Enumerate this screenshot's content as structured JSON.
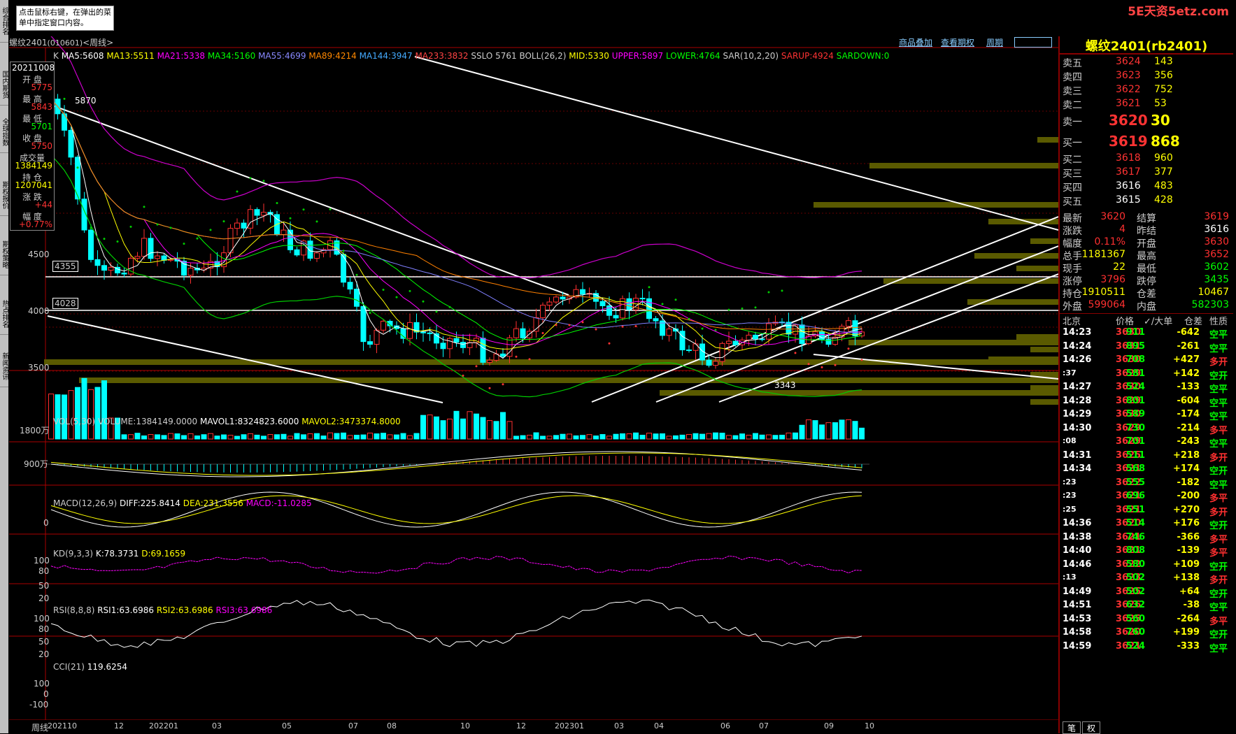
{
  "header": {
    "tip": "点击鼠标右键，在弹出的菜单中指定窗口内容。",
    "logo": "5E天资5etz.com"
  },
  "left_tabs": [
    "综合排名",
    "国内期货",
    "全球指数",
    "期权报价",
    "期权策略",
    "热点排名",
    "新闻资讯"
  ],
  "title": {
    "name": "螺纹2401",
    "code": "(010601)",
    "period": "<周线>"
  },
  "menu": {
    "overlay": "商品叠加",
    "options": "查看期权",
    "cycle": "周期"
  },
  "main_indicator": {
    "k": "K",
    "ma5": "MA5:5608",
    "ma13": "MA13:5511",
    "ma21": "MA21:5338",
    "ma34": "MA34:5160",
    "ma55": "MA55:4699",
    "ma89": "MA89:4214",
    "ma144": "MA144:3947",
    "ma233": "MA233:3832",
    "sslo": "SSLO 5761",
    "boll": "BOLL(26,2)",
    "mid": "MID:5330",
    "upper": "UPPER:5897",
    "lower": "LOWER:4764",
    "sar": "SAR(10,2,20)",
    "sarup": "SARUP:4924",
    "sardown": "SARDOWN:0"
  },
  "colors": {
    "up": "#ff3030",
    "down": "#00ffff",
    "ma5": "#ffffff",
    "ma13": "#ffff00",
    "ma21": "#ff00ff",
    "ma34": "#00ff00",
    "ma55": "#8080ff",
    "ma89": "#ff8000",
    "ma144": "#4080ff",
    "ma233": "#ff4040",
    "volume_band": "#5a5a00"
  },
  "infobox": {
    "date": "20211008",
    "open_label": "开 盘",
    "open": "5775",
    "high_label": "最 高",
    "high": "5843",
    "low_label": "最 低",
    "low": "5701",
    "close_label": "收 盘",
    "close": "5750",
    "vol_label": "成交量",
    "vol": "1384149",
    "oi_label": "持 仓",
    "oi": "1207041",
    "chg_label": "涨 跌",
    "chg": "+44",
    "pct_label": "幅 度",
    "pct": "+0.77%"
  },
  "price_axis": {
    "p4500": "4500",
    "p4000": "4000",
    "p3500": "3500",
    "mark4355": "4355",
    "mark4028": "4028",
    "high_mark": "5870",
    "low_mark": "3343"
  },
  "vol_indicator": {
    "name": "VOL(5,30)",
    "volume": "VOLUME:1384149.0000",
    "mavol1": "MAVOL1:8324823.6000",
    "mavol2": "MAVOL2:3473374.8000",
    "ax1": "1800万",
    "ax2": "900万"
  },
  "macd_indicator": {
    "name": "MACD(12,26,9)",
    "diff": "DIFF:225.8414",
    "dea": "DEA:231.3556",
    "macd": "MACD:-11.0285",
    "ax0": "0"
  },
  "kd_indicator": {
    "name": "KD(9,3,3)",
    "k": "K:78.3731",
    "d": "D:69.1659",
    "ax": [
      "100",
      "80",
      "50",
      "20"
    ]
  },
  "rsi_indicator": {
    "name": "RSI(8,8,8)",
    "r1": "RSI1:63.6986",
    "r2": "RSI2:63.6986",
    "r3": "RSI3:63.6986",
    "ax": [
      "100",
      "80",
      "50",
      "20"
    ]
  },
  "cci_indicator": {
    "name": "CCI(21)",
    "val": "119.6254",
    "ax": [
      "100",
      "0",
      "-100"
    ]
  },
  "xaxis": {
    "label": "周线",
    "ticks": [
      "202110",
      "12",
      "202201",
      "03",
      "05",
      "07",
      "08",
      "10",
      "12",
      "202301",
      "03",
      "04",
      "06",
      "07",
      "09",
      "10"
    ]
  },
  "quote": {
    "title": "螺纹2401(rb2401)",
    "asks": [
      {
        "l": "卖五",
        "p": "3624",
        "v": "143"
      },
      {
        "l": "卖四",
        "p": "3623",
        "v": "356"
      },
      {
        "l": "卖三",
        "p": "3622",
        "v": "752"
      },
      {
        "l": "卖二",
        "p": "3621",
        "v": "53"
      }
    ],
    "ask1": {
      "l": "卖一",
      "p": "3620",
      "v": "30"
    },
    "bid1": {
      "l": "买一",
      "p": "3619",
      "v": "868"
    },
    "bids": [
      {
        "l": "买二",
        "p": "3618",
        "v": "960"
      },
      {
        "l": "买三",
        "p": "3617",
        "v": "377"
      },
      {
        "l": "买四",
        "p": "3616",
        "v": "483"
      },
      {
        "l": "买五",
        "p": "3615",
        "v": "428"
      }
    ],
    "stats": [
      {
        "l1": "最新",
        "v1": "3620",
        "c1": "#ff3030",
        "l2": "结算",
        "v2": "3619",
        "c2": "#ff3030"
      },
      {
        "l1": "涨跌",
        "v1": "4",
        "c1": "#ff3030",
        "l2": "昨结",
        "v2": "3616",
        "c2": "#ffffff"
      },
      {
        "l1": "幅度",
        "v1": "0.11%",
        "c1": "#ff3030",
        "l2": "开盘",
        "v2": "3630",
        "c2": "#ff3030"
      },
      {
        "l1": "总手",
        "v1": "1181367",
        "c1": "#ffff00",
        "l2": "最高",
        "v2": "3652",
        "c2": "#ff3030"
      },
      {
        "l1": "现手",
        "v1": "22",
        "c1": "#ffff00",
        "l2": "最低",
        "v2": "3602",
        "c2": "#00ff00"
      },
      {
        "l1": "涨停",
        "v1": "3796",
        "c1": "#ff3030",
        "l2": "跌停",
        "v2": "3435",
        "c2": "#00ff00"
      },
      {
        "l1": "持仓",
        "v1": "1910511",
        "c1": "#ffff00",
        "l2": "仓差",
        "v2": "10467",
        "c2": "#ffff00"
      },
      {
        "l1": "外盘",
        "v1": "599064",
        "c1": "#ff3030",
        "l2": "内盘",
        "v2": "582303",
        "c2": "#00ff00"
      }
    ],
    "trade_header": {
      "h1": "北京",
      "h2": "价格",
      "h3": "✓/大单",
      "h4": "仓差",
      "h5": "性质"
    },
    "trades": [
      {
        "t": "14:23",
        "p": "3630",
        "v": "911",
        "d": "-642",
        "n": "空平",
        "nc": "#00ff00"
      },
      {
        "t": "14:24",
        "p": "3631",
        "v": "895",
        "d": "-261",
        "n": "空平",
        "nc": "#00ff00"
      },
      {
        "t": "14:26",
        "p": "3630",
        "v": "708",
        "d": "+427",
        "n": "多开",
        "nc": "#ff3030"
      },
      {
        "t": ":37",
        "p": "3629",
        "v": "581",
        "d": "+142",
        "n": "空开",
        "nc": "#00ff00"
      },
      {
        "t": "14:27",
        "p": "3630",
        "v": "524",
        "d": "-133",
        "n": "空平",
        "nc": "#00ff00"
      },
      {
        "t": "14:28",
        "p": "3629",
        "v": "801",
        "d": "-604",
        "n": "空平",
        "nc": "#00ff00"
      },
      {
        "t": "14:29",
        "p": "3630",
        "v": "589",
        "d": "-174",
        "n": "空平",
        "nc": "#00ff00"
      },
      {
        "t": "14:30",
        "p": "3629",
        "v": "730",
        "d": "-214",
        "n": "多平",
        "nc": "#ff3030"
      },
      {
        "t": ":08",
        "p": "3629",
        "v": "701",
        "d": "-243",
        "n": "空平",
        "nc": "#00ff00"
      },
      {
        "t": "14:31",
        "p": "3625",
        "v": "511",
        "d": "+218",
        "n": "多开",
        "nc": "#ff3030"
      },
      {
        "t": "14:34",
        "p": "3621",
        "v": "568",
        "d": "+174",
        "n": "空开",
        "nc": "#00ff00"
      },
      {
        "t": ":23",
        "p": "3622",
        "v": "555",
        "d": "-182",
        "n": "空平",
        "nc": "#00ff00"
      },
      {
        "t": ":23",
        "p": "3621",
        "v": "696",
        "d": "-200",
        "n": "多平",
        "nc": "#ff3030"
      },
      {
        "t": ":25",
        "p": "3621",
        "v": "551",
        "d": "+270",
        "n": "多开",
        "nc": "#ff3030"
      },
      {
        "t": "14:36",
        "p": "3620",
        "v": "514",
        "d": "+176",
        "n": "空开",
        "nc": "#00ff00"
      },
      {
        "t": "14:38",
        "p": "3621",
        "v": "746",
        "d": "-366",
        "n": "多平",
        "nc": "#ff3030"
      },
      {
        "t": "14:40",
        "p": "3621",
        "v": "808",
        "d": "-139",
        "n": "多平",
        "nc": "#ff3030"
      },
      {
        "t": "14:46",
        "p": "3622",
        "v": "580",
        "d": "+109",
        "n": "空开",
        "nc": "#00ff00"
      },
      {
        "t": ":13",
        "p": "3623",
        "v": "502",
        "d": "+138",
        "n": "多开",
        "nc": "#ff3030"
      },
      {
        "t": "14:49",
        "p": "3625",
        "v": "502",
        "d": "+64",
        "n": "空开",
        "nc": "#00ff00"
      },
      {
        "t": "14:51",
        "p": "3626",
        "v": "632",
        "d": "-38",
        "n": "空平",
        "nc": "#00ff00"
      },
      {
        "t": "14:53",
        "p": "3625",
        "v": "560",
        "d": "-264",
        "n": "多平",
        "nc": "#ff3030"
      },
      {
        "t": "14:58",
        "p": "3620",
        "v": "760",
        "d": "+199",
        "n": "空开",
        "nc": "#00ff00"
      },
      {
        "t": "14:59",
        "p": "3621",
        "v": "524",
        "d": "-333",
        "n": "空平",
        "nc": "#00ff00"
      }
    ],
    "tabs": [
      "笔",
      "权"
    ]
  }
}
